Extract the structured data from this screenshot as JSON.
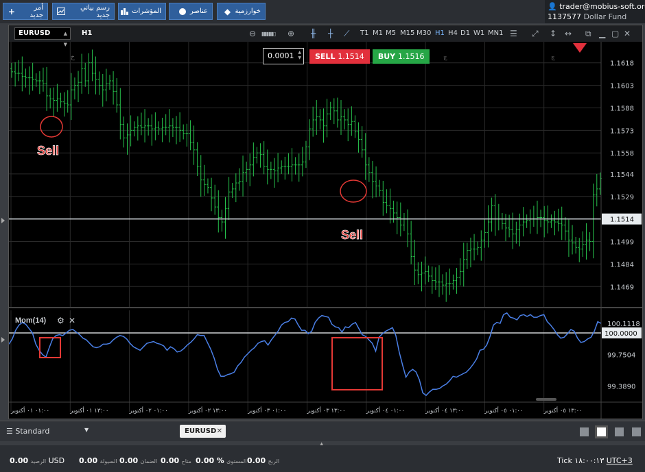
{
  "toolbar": {
    "new_order": "أمر جديد",
    "new_chart": "رسم بياني جديد",
    "indicators": "المؤشرات",
    "objects": "عناصر",
    "algorithm": "خوارزمية"
  },
  "account": {
    "email": "trader@mobius-soft.org",
    "number": "1137577",
    "fund": "Dollar Fund"
  },
  "chart_window": {
    "symbol": "EURUSD",
    "period": "H1",
    "timeframes": [
      "T1",
      "M1",
      "M5",
      "M15",
      "M30",
      "H1",
      "H4",
      "D1",
      "W1",
      "MN1"
    ],
    "active_timeframe": "H1"
  },
  "order": {
    "lot": "0.0001",
    "sell_label": "SELL",
    "sell_price": "1.1514",
    "buy_label": "BUY",
    "buy_price": "1.1516"
  },
  "annotations": {
    "sell1": "Sell",
    "sell2": "Sell"
  },
  "indicator": {
    "name": "Mom(14)"
  },
  "colors": {
    "bull": "#27c24c",
    "bear": "#27c24c",
    "momentum": "#4a7fe6",
    "sell": "#e2303c",
    "buy": "#26a646",
    "annotation": "#e53935"
  },
  "chart_data": [
    {
      "type": "candlestick",
      "symbol": "EURUSD",
      "timeframe": "H1",
      "price_axis_ticks": [
        "1.1618",
        "1.1603",
        "1.1588",
        "1.1573",
        "1.1558",
        "1.1544",
        "1.1529",
        "1.1514",
        "1.1499",
        "1.1484",
        "1.1469"
      ],
      "current_price": "1.1514",
      "ylim": [
        1.1455,
        1.1632
      ],
      "closes": [
        1.1612,
        1.1611,
        1.1611,
        1.1609,
        1.1608,
        1.1608,
        1.1607,
        1.1606,
        1.1606,
        1.1604,
        1.1596,
        1.1594,
        1.1593,
        1.1594,
        1.1592,
        1.1591,
        1.159,
        1.16,
        1.1603,
        1.1605,
        1.1614,
        1.1606,
        1.1618,
        1.1611,
        1.1607,
        1.1603,
        1.16,
        1.1604,
        1.1606,
        1.1599,
        1.159,
        1.1577,
        1.1568,
        1.157,
        1.1573,
        1.1575,
        1.1576,
        1.1575,
        1.1576,
        1.1576,
        1.1574,
        1.1575,
        1.1574,
        1.1575,
        1.1575,
        1.1576,
        1.1575,
        1.1575,
        1.1573,
        1.1571,
        1.1571,
        1.1565,
        1.156,
        1.1549,
        1.154,
        1.1537,
        1.1535,
        1.1528,
        1.1522,
        1.1515,
        1.1512,
        1.1521,
        1.1532,
        1.1534,
        1.1538,
        1.1539,
        1.1545,
        1.1547,
        1.155,
        1.1555,
        1.1558,
        1.1557,
        1.1549,
        1.1547,
        1.1547,
        1.1546,
        1.1548,
        1.1549,
        1.1549,
        1.1549,
        1.155,
        1.155,
        1.155,
        1.1552,
        1.1562,
        1.1574,
        1.158,
        1.1582,
        1.158,
        1.1576,
        1.1584,
        1.1588,
        1.1586,
        1.158,
        1.1582,
        1.158,
        1.1577,
        1.1579,
        1.1572,
        1.1567,
        1.156,
        1.155,
        1.1545,
        1.1539,
        1.1536,
        1.1533,
        1.1525,
        1.1523,
        1.1521,
        1.1518,
        1.1515,
        1.151,
        1.1514,
        1.1504,
        1.1489,
        1.148,
        1.1477,
        1.1478,
        1.1479,
        1.1476,
        1.1473,
        1.1472,
        1.1472,
        1.147,
        1.1471,
        1.1471,
        1.1473,
        1.1475,
        1.1479,
        1.1487,
        1.1493,
        1.1494,
        1.1494,
        1.1495,
        1.15,
        1.1505,
        1.1512,
        1.1523,
        1.1514,
        1.1514,
        1.1511,
        1.1508,
        1.1507,
        1.1504,
        1.1507,
        1.151,
        1.1512,
        1.1513,
        1.1514,
        1.1514,
        1.1515,
        1.1515,
        1.1513,
        1.1512,
        1.1513,
        1.1512,
        1.1511,
        1.151,
        1.1506,
        1.15,
        1.1498,
        1.1495,
        1.1494,
        1.1497,
        1.15,
        1.1499,
        1.153,
        1.1534,
        1.1541
      ]
    },
    {
      "type": "line",
      "name": "Mom(14)",
      "y_axis_ticks": [
        "100.1118",
        "100.0000",
        "99.7504",
        "99.3890"
      ],
      "reference_level": "100.0000",
      "ylim": [
        99.25,
        100.26
      ],
      "values": [
        99.87,
        99.93,
        100.03,
        100.09,
        100.12,
        100.1,
        100.05,
        100.0,
        99.87,
        99.8,
        99.75,
        99.72,
        99.83,
        99.93,
        99.97,
        99.98,
        99.97,
        100.0,
        100.03,
        100.04,
        100.01,
        99.98,
        99.94,
        99.92,
        99.88,
        99.84,
        99.83,
        99.84,
        99.87,
        99.87,
        99.88,
        99.92,
        99.95,
        99.97,
        99.96,
        99.93,
        99.88,
        99.84,
        99.82,
        99.8,
        99.84,
        99.88,
        99.89,
        99.9,
        99.88,
        99.87,
        99.85,
        99.8,
        99.84,
        99.82,
        99.78,
        99.79,
        99.82,
        99.86,
        99.89,
        99.93,
        99.98,
        99.97,
        99.97,
        99.89,
        99.81,
        99.71,
        99.58,
        99.5,
        99.5,
        99.52,
        99.53,
        99.55,
        99.62,
        99.66,
        99.72,
        99.76,
        99.8,
        99.83,
        99.88,
        99.9,
        99.91,
        99.86,
        99.92,
        99.97,
        100.02,
        100.09,
        100.12,
        100.13,
        100.17,
        100.16,
        100.09,
        100.03,
        100.03,
        99.99,
        100.02,
        100.12,
        100.17,
        100.2,
        100.19,
        100.18,
        100.1,
        100.07,
        100.06,
        100.01,
        100.07,
        100.06,
        100.1,
        100.12,
        100.05,
        99.98,
        99.96,
        99.92,
        99.88,
        99.79,
        99.95,
        99.99,
        100.02,
        100.04,
        100.06,
        99.97,
        99.78,
        99.63,
        99.49,
        99.55,
        99.58,
        99.55,
        99.46,
        99.31,
        99.28,
        99.32,
        99.35,
        99.35,
        99.36,
        99.39,
        99.41,
        99.45,
        99.5,
        99.49,
        99.51,
        99.53,
        99.55,
        99.59,
        99.64,
        99.7,
        99.8,
        99.81,
        99.86,
        99.96,
        100.09,
        100.12,
        100.11,
        100.21,
        100.23,
        100.18,
        100.17,
        100.15,
        100.2,
        100.21,
        100.19,
        100.21,
        100.18,
        100.18,
        100.2,
        100.21,
        100.13,
        100.09,
        100.04,
        99.98,
        99.94,
        99.95,
        99.99,
        100.04,
        100.02,
        99.94,
        99.89,
        99.9,
        99.93,
        99.95,
        100.02,
        100.13,
        100.11
      ]
    }
  ],
  "x_axis_ticks": [
    "٠١:٠٠ ٠١ أكتوبر",
    "١٣:٠٠ ٠١ أكتوبر",
    "٠١:٠٠ ٠٢ أكتوبر",
    "١٣:٠٠ ٠٢ أكتوبر",
    "٠١:٠٠ ٠٣ أكتوبر",
    "١٣:٠٠ ٠٣ أكتوبر",
    "٠١:٠٠ ٠٤ أكتوبر",
    "١٣:٠٠ ٠٤ أكتوبر",
    "٠١:٠٠ ٠٥ أكتوبر",
    "١٣:٠٠ ٠٥ أكتوبر"
  ],
  "top_labels": [
    "خ",
    "ج",
    "ج"
  ],
  "tabs": {
    "layout": "Standard",
    "symbol_tab": "EURUSD"
  },
  "status": {
    "balance_value": "0.00",
    "balance_label": "الرصيد",
    "currency": "USD",
    "equity_value": "0.00",
    "equity_label": "السيولة",
    "margin_value": "0.00",
    "margin_label": "الضمان",
    "free_value": "0.00",
    "free_label": "متاح",
    "level_value": "%",
    "level_label": "المستوى",
    "profit_value": "0.00",
    "profit_label": "الربح",
    "tick_label": "Tick",
    "time": "١٨:٠٠:١٣",
    "timezone": "UTC+3"
  }
}
